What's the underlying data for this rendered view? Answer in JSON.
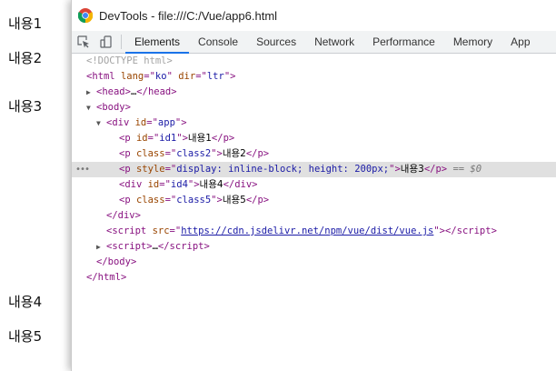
{
  "background": {
    "texts": [
      "내용1",
      "내용2",
      "내용3",
      "내용4",
      "내용5"
    ]
  },
  "devtools": {
    "window_title": "DevTools - file:///C:/Vue/app6.html",
    "tabs": [
      "Elements",
      "Console",
      "Sources",
      "Network",
      "Performance",
      "Memory",
      "App"
    ],
    "active_tab": "Elements",
    "icons": [
      "chrome-icon",
      "inspect-icon",
      "device-toolbar-icon"
    ]
  },
  "dom": {
    "doctype": "<!DOCTYPE html>",
    "html_tag": "html",
    "html_lang_attr": "lang",
    "html_lang_val": "ko",
    "html_dir_attr": "dir",
    "html_dir_val": "ltr",
    "head": "head",
    "head_ellipsis": "…",
    "body": "body",
    "div_app_attr": "id",
    "div_app_val": "app",
    "p1_attr": "id",
    "p1_val": "id1",
    "p1_text": "내용1",
    "p2_attr": "class",
    "p2_val": "class2",
    "p2_text": "내용2",
    "p3_attr": "style",
    "p3_val": "display: inline-block; height: 200px;",
    "p3_text": "내용3",
    "selected_marker": "== $0",
    "div4_attr": "id",
    "div4_val": "id4",
    "div4_text": "내용4",
    "p5_attr": "class",
    "p5_val": "class5",
    "p5_text": "내용5",
    "script_src_attr": "src",
    "script_src_val": "https://cdn.jsdelivr.net/npm/vue/dist/vue.js",
    "script2_ellipsis": "…"
  },
  "colors": {
    "tag": "#881280",
    "attribute": "#994500",
    "value": "#1a1aa6",
    "selection": "#e0e0e0",
    "active_tab_underline": "#1a73e8"
  }
}
